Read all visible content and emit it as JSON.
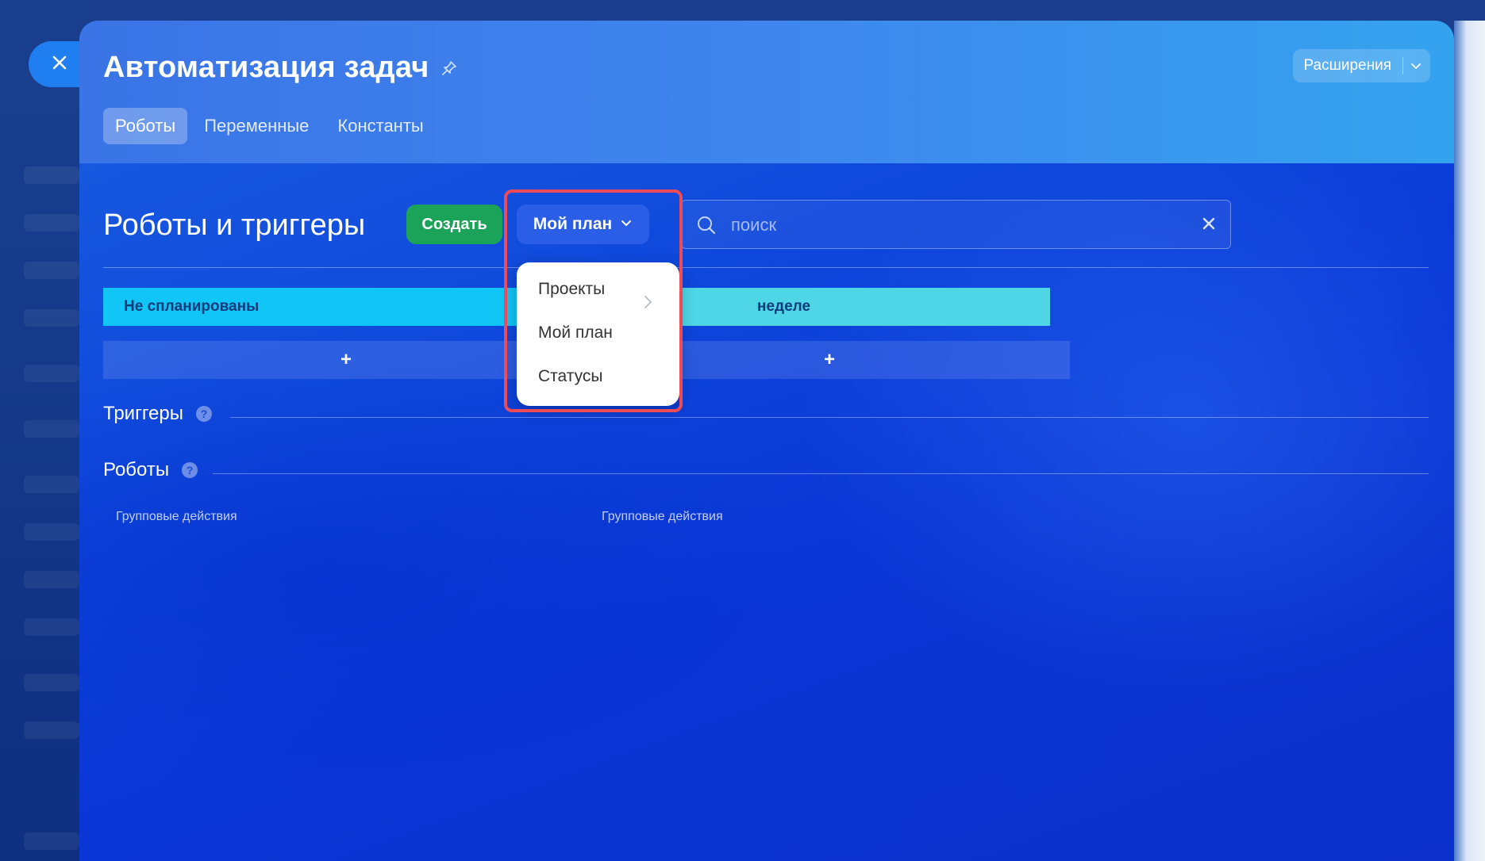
{
  "window": {
    "title": "Автоматизация задач",
    "extensions_label": "Расширения"
  },
  "tabs": [
    {
      "label": "Роботы",
      "active": true
    },
    {
      "label": "Переменные",
      "active": false
    },
    {
      "label": "Константы",
      "active": false
    }
  ],
  "toolbar": {
    "section_title": "Роботы и триггеры",
    "create_label": "Создать",
    "plan_label": "Мой план",
    "search_placeholder": "поиск"
  },
  "plan_menu": {
    "items": [
      {
        "label": "Проекты",
        "has_submenu": true
      },
      {
        "label": "Мой план",
        "has_submenu": false
      },
      {
        "label": "Статусы",
        "has_submenu": false
      }
    ]
  },
  "stages": [
    {
      "label": "Не спланированы",
      "color": "#12c5f7"
    },
    {
      "label": "неделе",
      "color": "#4ed6e6"
    }
  ],
  "add_label": "+",
  "sections": {
    "triggers": "Триггеры",
    "robots": "Роботы",
    "help": "?"
  },
  "group_actions": [
    "Групповые действия",
    "Групповые действия"
  ],
  "colors": {
    "create_button": "#1ca35a",
    "highlight": "#ef4b56",
    "plan_button": "#2a5ee6"
  }
}
